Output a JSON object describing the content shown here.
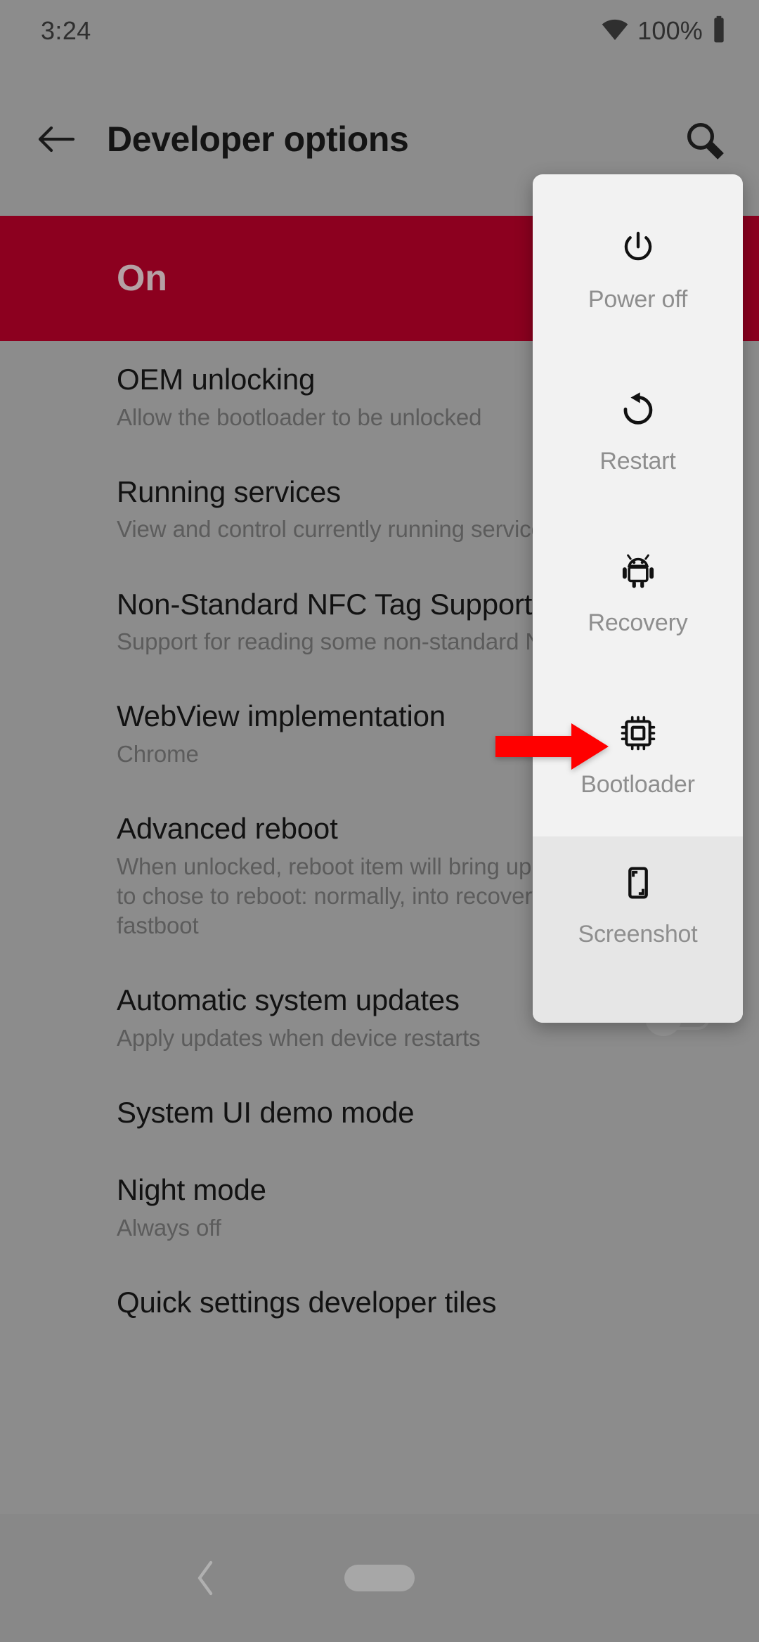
{
  "status_bar": {
    "time": "3:24",
    "battery_percent": "100%",
    "wifi_icon": "wifi-icon",
    "battery_icon": "battery-full-icon"
  },
  "app_bar": {
    "title": "Developer options",
    "back_icon": "back-arrow-icon",
    "search_icon": "search-icon"
  },
  "banner": {
    "label": "On"
  },
  "settings": [
    {
      "title": "OEM unlocking",
      "summary": "Allow the bootloader to be unlocked",
      "has_toggle": false
    },
    {
      "title": "Running services",
      "summary": "View and control currently running services",
      "has_toggle": false
    },
    {
      "title": "Non-Standard NFC Tag Support",
      "summary": "Support for reading some non-standard NFC tags",
      "has_toggle": false
    },
    {
      "title": "WebView implementation",
      "summary": "Chrome",
      "has_toggle": false
    },
    {
      "title": "Advanced reboot",
      "summary": "When unlocked, reboot item will bring up a dialog to chose to reboot: normally, into recovery or fastboot",
      "has_toggle": false
    },
    {
      "title": "Automatic system updates",
      "summary": "Apply updates when device restarts",
      "has_toggle": true,
      "toggle_state": "off"
    },
    {
      "title": "System UI demo mode",
      "summary": "",
      "has_toggle": false
    },
    {
      "title": "Night mode",
      "summary": "Always off",
      "has_toggle": false
    },
    {
      "title": "Quick settings developer tiles",
      "summary": "",
      "has_toggle": false
    }
  ],
  "power_menu": {
    "items": [
      {
        "label": "Power off",
        "icon": "power-off-icon"
      },
      {
        "label": "Restart",
        "icon": "restart-icon"
      },
      {
        "label": "Recovery",
        "icon": "android-robot-icon"
      },
      {
        "label": "Bootloader",
        "icon": "cpu-chip-icon"
      }
    ],
    "secondary": {
      "label": "Screenshot",
      "icon": "screenshot-icon"
    }
  },
  "annotation": {
    "arrow_icon": "red-right-arrow-icon",
    "arrow_color": "#FF0000",
    "points_at": "Bootloader"
  },
  "nav_bar": {
    "back_icon": "nav-back-chevron-icon",
    "home_icon": "nav-home-pill-icon"
  },
  "colors": {
    "banner_red": "#8c001f",
    "scrim_gray": "#8c8c8c",
    "popup_bg": "#f2f2f2",
    "popup_secondary_bg": "#e6e6e6",
    "annotation_red": "#FF0000"
  }
}
